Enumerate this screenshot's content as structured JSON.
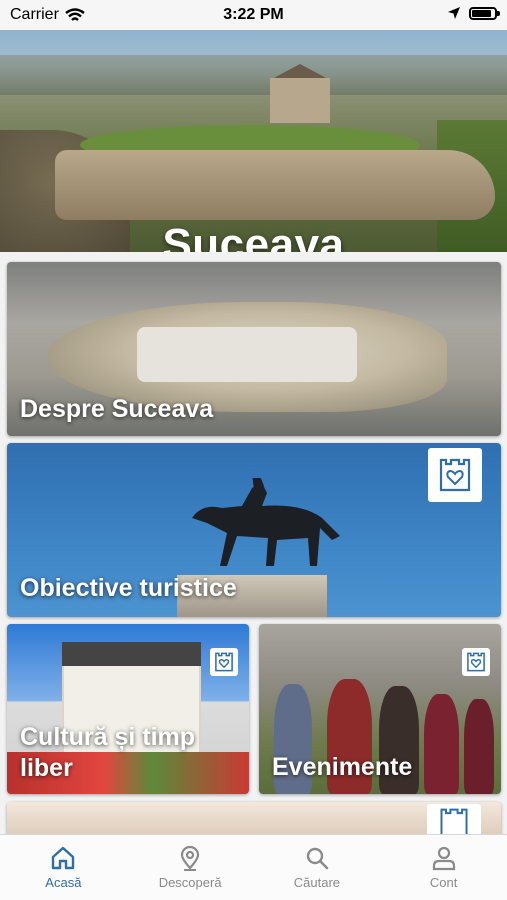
{
  "status_bar": {
    "carrier": "Carrier",
    "time": "3:22 PM",
    "battery_level": 0.9
  },
  "hero": {
    "title": "Suceava"
  },
  "cards": [
    {
      "label": "Despre Suceava",
      "badge": false
    },
    {
      "label": "Obiective turistice",
      "badge": true,
      "badge_icon": "castle-heart-icon"
    },
    {
      "label": "Cultură și timp liber",
      "badge": true,
      "badge_icon": "castle-heart-icon"
    },
    {
      "label": "Evenimente",
      "badge": true,
      "badge_icon": "castle-heart-icon"
    }
  ],
  "tabs": [
    {
      "label": "Acasă",
      "icon": "home-icon",
      "active": true
    },
    {
      "label": "Descoperă",
      "icon": "location-pin-icon",
      "active": false
    },
    {
      "label": "Căutare",
      "icon": "search-icon",
      "active": false
    },
    {
      "label": "Cont",
      "icon": "user-icon",
      "active": false
    }
  ],
  "colors": {
    "accent": "#2d6ea8",
    "tab_inactive": "#8a8a8a",
    "badge_blue": "#2d6ea8"
  }
}
